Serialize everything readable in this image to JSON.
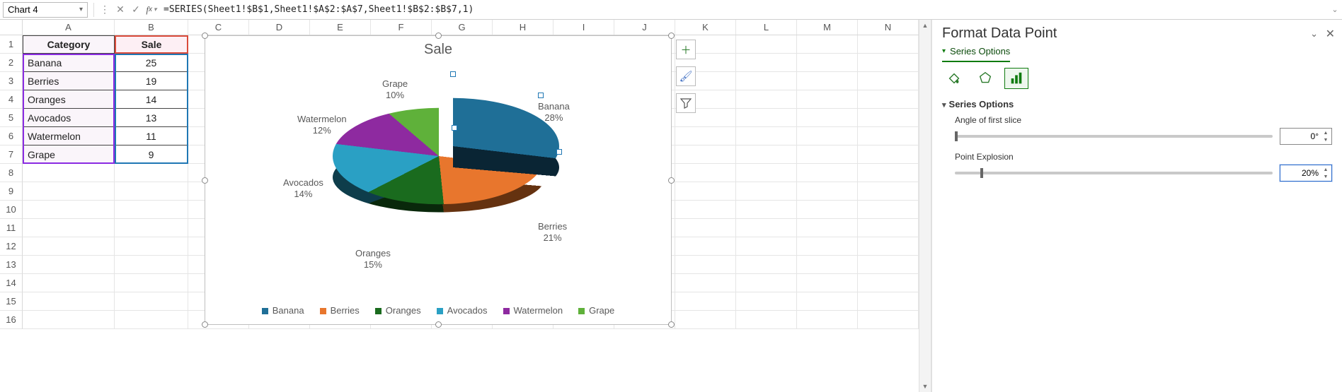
{
  "formula_bar": {
    "name_box": "Chart 4",
    "formula": "=SERIES(Sheet1!$B$1,Sheet1!$A$2:$A$7,Sheet1!$B$2:$B$7,1)"
  },
  "columns": [
    "A",
    "B",
    "C",
    "D",
    "E",
    "F",
    "G",
    "H",
    "I",
    "J",
    "K",
    "L",
    "M",
    "N"
  ],
  "row_numbers": [
    "1",
    "2",
    "3",
    "4",
    "5",
    "6",
    "7",
    "8",
    "9",
    "10",
    "11",
    "12",
    "13",
    "14",
    "15",
    "16"
  ],
  "table": {
    "headers": {
      "a": "Category",
      "b": "Sale"
    },
    "rows": [
      {
        "a": "Banana",
        "b": "25"
      },
      {
        "a": "Berries",
        "b": "19"
      },
      {
        "a": "Oranges",
        "b": "14"
      },
      {
        "a": "Avocados",
        "b": "13"
      },
      {
        "a": "Watermelon",
        "b": "11"
      },
      {
        "a": "Grape",
        "b": "9"
      }
    ]
  },
  "chart": {
    "title": "Sale",
    "labels": {
      "banana": "Banana\n28%",
      "berries": "Berries\n21%",
      "oranges": "Oranges\n15%",
      "avocados": "Avocados\n14%",
      "watermelon": "Watermelon\n12%",
      "grape": "Grape\n10%"
    },
    "legend": {
      "banana": "Banana",
      "berries": "Berries",
      "oranges": "Oranges",
      "avocados": "Avocados",
      "watermelon": "Watermelon",
      "grape": "Grape"
    },
    "colors": {
      "banana": "#1f6f97",
      "berries": "#e8762d",
      "oranges": "#1a6b1e",
      "avocados": "#2aa0c4",
      "watermelon": "#8e2aa0",
      "grape": "#5fb13a"
    }
  },
  "chart_data": {
    "type": "pie",
    "title": "Sale",
    "categories": [
      "Banana",
      "Berries",
      "Oranges",
      "Avocados",
      "Watermelon",
      "Grape"
    ],
    "values": [
      25,
      19,
      14,
      13,
      11,
      9
    ],
    "percent": [
      28,
      21,
      15,
      14,
      12,
      10
    ],
    "effects": {
      "3d": true,
      "exploded_index": 0,
      "explosion_pct": 20
    },
    "legend_position": "bottom"
  },
  "pane": {
    "title": "Format Data Point",
    "dropdown": "Series Options",
    "section": "Series Options",
    "angle_label": "Angle of first slice",
    "angle_value": "0°",
    "explosion_label": "Point Explosion",
    "explosion_value": "20%"
  }
}
